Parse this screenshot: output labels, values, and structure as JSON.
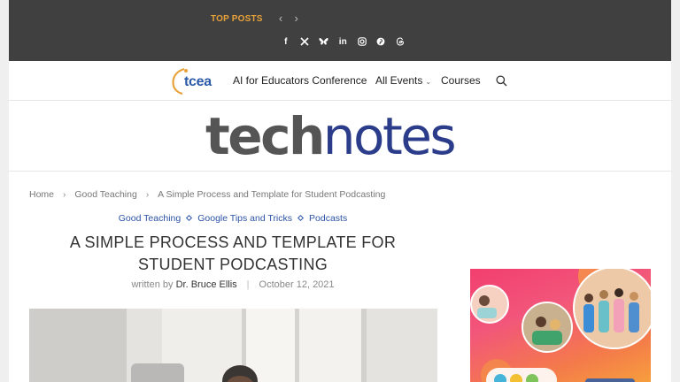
{
  "topbar": {
    "top_posts_label": "TOP POSTS",
    "prev_label": "‹",
    "next_label": "›",
    "social_icons": [
      "facebook-icon",
      "x-icon",
      "bluesky-icon",
      "linkedin-icon",
      "instagram-icon",
      "pinterest-icon",
      "threads-icon"
    ],
    "social_glyphs": {
      "facebook": "f",
      "x": "𝕏",
      "linkedin": "in"
    },
    "bg_color": "#404040",
    "accent_color": "#e8a23a"
  },
  "nav": {
    "logo_text": "tcea",
    "items": [
      {
        "label": "AI for Educators Conference"
      },
      {
        "label": "All Events",
        "has_dropdown": true
      },
      {
        "label": "Courses"
      }
    ],
    "dropdown_glyph": "⌄"
  },
  "brand": {
    "part1": "tech",
    "part2": "notes",
    "part1_color": "#555555",
    "part2_color": "#2b3d8a"
  },
  "breadcrumb": {
    "items": [
      "Home",
      "Good Teaching",
      "A Simple Process and Template for Student Podcasting"
    ],
    "separator": "›"
  },
  "article": {
    "categories": [
      "Good Teaching",
      "Google Tips and Tricks",
      "Podcasts"
    ],
    "title_line1": "A SIMPLE PROCESS AND TEMPLATE FOR",
    "title_line2": "STUDENT PODCASTING",
    "byline_prefix": "written by",
    "author": "Dr. Bruce Ellis",
    "date": "October 12, 2021",
    "category_color": "#2b52a6"
  }
}
